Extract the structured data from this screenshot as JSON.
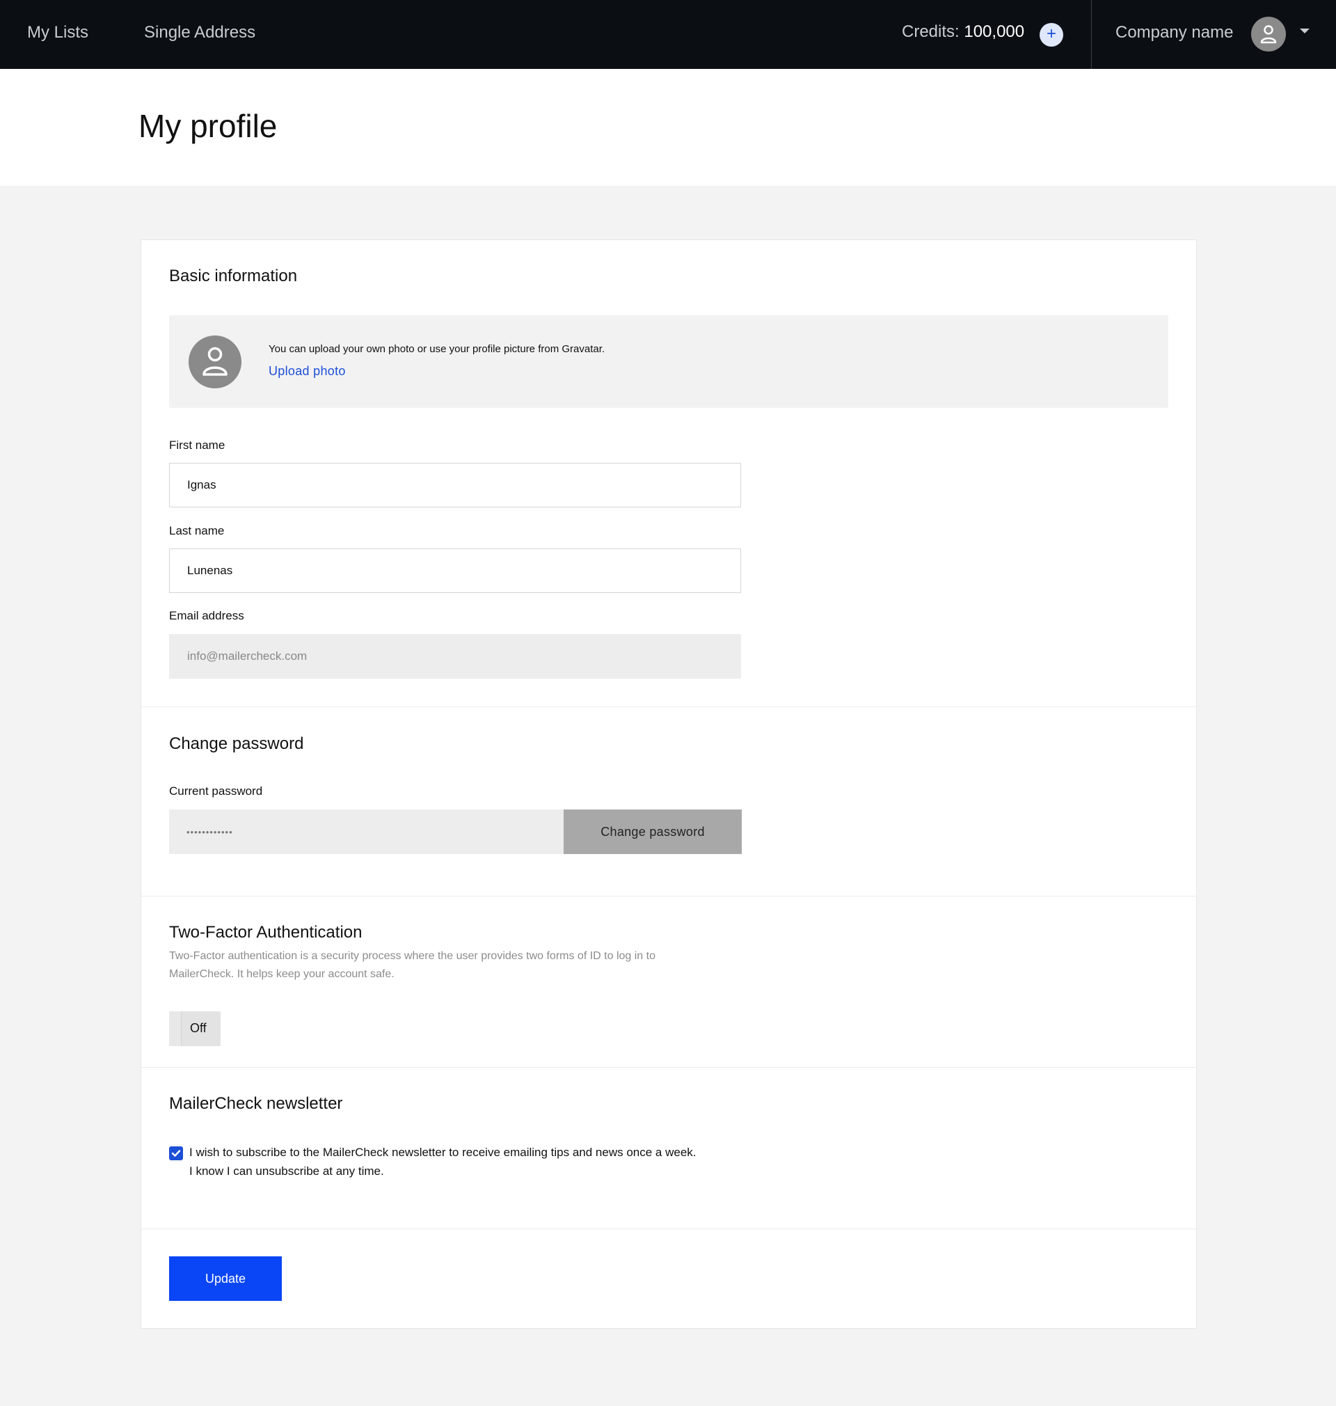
{
  "nav": {
    "links": [
      {
        "label": "My Lists"
      },
      {
        "label": "Single Address"
      }
    ],
    "credits_label": "Credits:",
    "credits_value": "100,000",
    "add_credits_symbol": "+",
    "company_name": "Company name",
    "icons": [
      "plus-icon",
      "user-icon",
      "caret-down-icon"
    ]
  },
  "page": {
    "title": "My profile"
  },
  "basic_info": {
    "title": "Basic information",
    "photo_text": "You can upload your own photo or use your profile picture from Gravatar.",
    "upload_label": "Upload photo",
    "first_name_label": "First name",
    "first_name_value": "Ignas",
    "last_name_label": "Last name",
    "last_name_value": "Lunenas",
    "email_label": "Email address",
    "email_value": "info@mailercheck.com"
  },
  "password": {
    "title": "Change password",
    "current_label": "Current password",
    "current_value": "••••••••••••",
    "button_label": "Change password"
  },
  "two_factor": {
    "title": "Two-Factor Authentication",
    "description": "Two-Factor authentication is a security process where the user provides two forms of ID to log in to MailerCheck. It helps keep your account safe.",
    "toggle_label": "Off",
    "enabled": false
  },
  "newsletter": {
    "title": "MailerCheck newsletter",
    "checked": true,
    "line1": "I wish to subscribe to the MailerCheck newsletter to receive emailing tips and news once a week.",
    "line2": "I know I can unsubscribe at any time."
  },
  "actions": {
    "update_label": "Update"
  },
  "colors": {
    "topbar": "#0b0f14",
    "accent": "#0a46f5",
    "link": "#1b4fd6",
    "page_background": "#f3f3f3"
  }
}
